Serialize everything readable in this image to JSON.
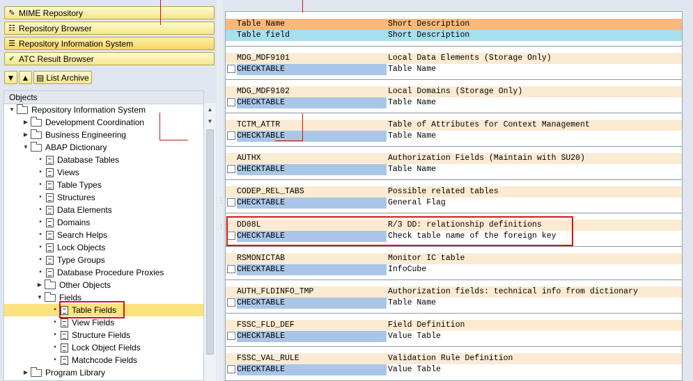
{
  "nav_buttons": [
    {
      "label": "MIME Repository",
      "icon": "mime-icon"
    },
    {
      "label": "Repository Browser",
      "icon": "hierarchy-icon"
    },
    {
      "label": "Repository Information System",
      "icon": "info-system-icon"
    },
    {
      "label": "ATC Result Browser",
      "icon": "check-icon"
    }
  ],
  "toolbar": {
    "list_archive_label": "List Archive"
  },
  "tree": {
    "header": "Objects",
    "items": [
      {
        "label": "Repository Information System"
      },
      {
        "label": "Development Coordination"
      },
      {
        "label": "Business Engineering"
      },
      {
        "label": "ABAP Dictionary"
      },
      {
        "label": "Database Tables"
      },
      {
        "label": "Views"
      },
      {
        "label": "Table Types"
      },
      {
        "label": "Structures"
      },
      {
        "label": "Data Elements"
      },
      {
        "label": "Domains"
      },
      {
        "label": "Search Helps"
      },
      {
        "label": "Lock Objects"
      },
      {
        "label": "Type Groups"
      },
      {
        "label": "Database Procedure Proxies"
      },
      {
        "label": "Other Objects"
      },
      {
        "label": "Fields"
      },
      {
        "label": "Table Fields"
      },
      {
        "label": "View Fields"
      },
      {
        "label": "Structure Fields"
      },
      {
        "label": "Lock Object Fields"
      },
      {
        "label": "Matchcode Fields"
      },
      {
        "label": "Program Library"
      }
    ]
  },
  "list": {
    "header1": {
      "col1": "Table Name",
      "col2": "Short Description"
    },
    "header2": {
      "col1": "Table field",
      "col2": "Short Description"
    },
    "entries": [
      {
        "table": "MDG_MDF9101",
        "short_desc": "Local Data Elements (Storage Only)",
        "field": "CHECKTABLE",
        "field_desc": "Table Name"
      },
      {
        "table": "MDG_MDF9102",
        "short_desc": "Local Domains (Storage Only)",
        "field": "CHECKTABLE",
        "field_desc": "Table Name"
      },
      {
        "table": "TCTM_ATTR",
        "short_desc": "Table of Attributes for Context Management",
        "field": "CHECKTABLE",
        "field_desc": "Table Name"
      },
      {
        "table": "AUTHX",
        "short_desc": "Authorization Fields (Maintain with SU20)",
        "field": "CHECKTABLE",
        "field_desc": "Table Name"
      },
      {
        "table": "CODEP_REL_TABS",
        "short_desc": "Possible related tables",
        "field": "CHECKTABLE",
        "field_desc": "General Flag"
      },
      {
        "table": "DD08L",
        "short_desc": "R/3 DD: relationship definitions",
        "field": "CHECKTABLE",
        "field_desc": "Check table name of the foreign key"
      },
      {
        "table": "RSMONICTAB",
        "short_desc": "Monitor IC table",
        "field": "CHECKTABLE",
        "field_desc": "InfoCube"
      },
      {
        "table": "AUTH_FLDINFO_TMP",
        "short_desc": "Authorization fields:  technical info from dictionary",
        "field": "CHECKTABLE",
        "field_desc": "Table Name"
      },
      {
        "table": "FSSC_FLD_DEF",
        "short_desc": "Field Definition",
        "field": "CHECKTABLE",
        "field_desc": "Value Table"
      },
      {
        "table": "FSSC_VAL_RULE",
        "short_desc": "Validation Rule Definition",
        "field": "CHECKTABLE",
        "field_desc": "Value Table"
      }
    ]
  },
  "colors": {
    "header1_bg": "#f9b97a",
    "header2_bg": "#a6dfee",
    "entry_title_bg": "#fbebd3",
    "field_bg": "#a9c6e8",
    "selection_bg": "#fbe47f",
    "annotation_red": "#e01010"
  }
}
